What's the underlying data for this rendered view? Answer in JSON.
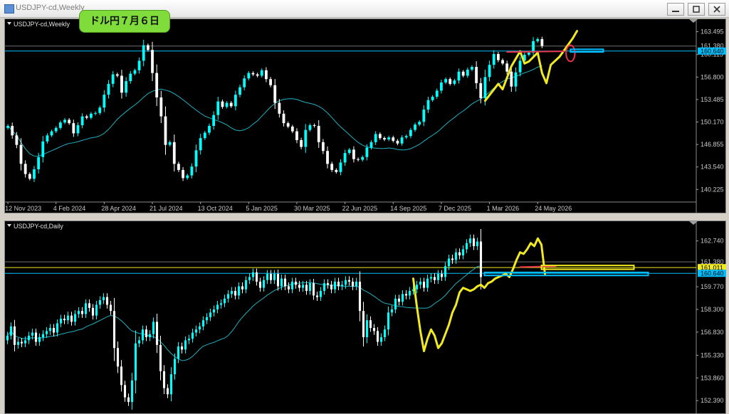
{
  "window": {
    "title": "USDJPY-cd,Weekly",
    "badge": "ドル円７月６日"
  },
  "colors": {
    "bull": "#00ffff",
    "bear": "#ffffff",
    "ma": "#20b0c0",
    "yellow": "#f2ea20",
    "red": "#e8334b",
    "line": "#00bfff",
    "axis": "#c8c8c8",
    "accent": "#7fdc3a"
  },
  "chart_data": [
    {
      "type": "candlestick",
      "title": "USDJPY-cd,Weekly",
      "ylim": [
        139.0,
        164.6
      ],
      "yticks": [
        "163.495",
        "160.115",
        "156.800",
        "153.485",
        "150.170",
        "146.855",
        "143.540",
        "140.225"
      ],
      "xticks": [
        "12 Nov 2023",
        "4 Feb 2024",
        "28 Apr 2024",
        "21 Jul 2024",
        "13 Oct 2024",
        "5 Jan 2025",
        "30 Mar 2025",
        "22 Jun 2025",
        "14 Sep 2025",
        "7 Dec 2025",
        "1 Mar 2026",
        "24 May 2026"
      ],
      "price_labels": [
        {
          "value": 161.38,
          "text": "161.380",
          "style": "plain"
        },
        {
          "value": 160.64,
          "text": "160.640",
          "style": "highlight"
        }
      ],
      "closes": [
        149.6,
        148.2,
        146.8,
        144.0,
        142.5,
        141.8,
        143.2,
        145.0,
        147.3,
        148.2,
        148.8,
        149.3,
        150.1,
        150.5,
        150.0,
        148.5,
        149.7,
        151.0,
        150.8,
        151.4,
        151.5,
        152.3,
        154.2,
        155.8,
        157.2,
        157.0,
        154.5,
        156.2,
        157.3,
        157.8,
        159.2,
        161.5,
        160.8,
        157.4,
        153.8,
        151.0,
        146.8,
        147.2,
        144.0,
        143.1,
        141.9,
        142.3,
        143.6,
        146.0,
        147.8,
        148.6,
        149.6,
        151.2,
        153.2,
        152.4,
        153.0,
        152.5,
        154.2,
        155.3,
        156.6,
        157.4,
        157.2,
        157.0,
        157.8,
        156.5,
        155.6,
        153.0,
        151.4,
        150.0,
        149.5,
        148.8,
        147.5,
        146.5,
        149.0,
        149.7,
        149.6,
        147.2,
        145.9,
        144.0,
        143.1,
        142.8,
        144.2,
        145.6,
        146.1,
        144.7,
        144.6,
        145.0,
        146.4,
        147.2,
        148.4,
        147.8,
        147.6,
        147.9,
        147.4,
        147.0,
        147.9,
        148.1,
        149.0,
        149.8,
        150.2,
        152.0,
        153.4,
        153.9,
        154.8,
        156.0,
        156.5,
        155.8,
        156.3,
        157.6,
        157.0,
        157.9,
        158.3,
        155.9,
        153.7,
        156.8,
        158.6,
        160.2,
        159.3,
        158.8,
        157.6,
        155.4,
        157.5,
        159.2,
        160.1,
        160.4,
        162.1,
        162.4,
        161.4
      ],
      "ma_period": 20,
      "overlay_marks": [
        {
          "kind": "line",
          "color": "yellow",
          "points": [
            [
              109,
              153.3
            ],
            [
              112,
              155.8
            ],
            [
              113,
              155.0
            ],
            [
              115,
              158.4
            ],
            [
              117,
              160.6
            ],
            [
              118,
              158.8
            ],
            [
              119,
              159.1
            ],
            [
              121,
              160.4
            ],
            [
              122,
              157.4
            ],
            [
              123,
              155.9
            ],
            [
              124,
              158.6
            ],
            [
              126,
              159.8
            ],
            [
              129,
              162.5
            ],
            [
              130,
              163.6
            ]
          ]
        },
        {
          "kind": "line",
          "color": "red",
          "points": [
            [
              114,
              160.5
            ],
            [
              127,
              160.6
            ]
          ]
        },
        {
          "kind": "ellipse",
          "color": "red",
          "center": [
            128.5,
            160.3
          ],
          "radii": [
            1.0,
            1.2
          ]
        },
        {
          "kind": "rect",
          "color": "line",
          "x": [
            128.5,
            136
          ],
          "y": [
            160.5,
            160.9
          ]
        }
      ]
    },
    {
      "type": "candlestick",
      "title": "USDJPY-cd,Daily",
      "ylim": [
        151.8,
        163.6
      ],
      "yticks": [
        "162.740",
        "161.380",
        "161.011",
        "160.640",
        "159.770",
        "158.300",
        "156.830",
        "155.330",
        "153.860",
        "152.390"
      ],
      "price_labels": [
        {
          "value": 161.38,
          "text": "161.380",
          "style": "plain"
        },
        {
          "value": 161.011,
          "text": "161.011",
          "style": "yellow"
        },
        {
          "value": 160.64,
          "text": "160.640",
          "style": "highlight"
        }
      ],
      "closes": [
        156.6,
        157.2,
        156.0,
        156.2,
        156.1,
        156.3,
        156.6,
        156.8,
        156.2,
        156.5,
        156.7,
        156.9,
        157.1,
        156.8,
        157.4,
        157.7,
        157.6,
        157.9,
        157.5,
        158.0,
        158.2,
        158.0,
        158.7,
        158.4,
        157.9,
        158.6,
        158.9,
        159.1,
        158.6,
        158.2,
        155.8,
        154.6,
        153.4,
        152.6,
        152.3,
        153.7,
        156.1,
        156.3,
        157.0,
        156.5,
        156.7,
        157.5,
        156.0,
        154.3,
        153.2,
        152.8,
        154.1,
        155.1,
        155.9,
        155.7,
        156.3,
        156.4,
        156.8,
        157.0,
        157.2,
        157.6,
        157.8,
        158.1,
        158.3,
        158.6,
        158.7,
        159.0,
        159.3,
        159.5,
        159.2,
        159.8,
        159.6,
        160.2,
        160.4,
        160.7,
        160.1,
        159.7,
        160.2,
        160.6,
        160.2,
        160.6,
        159.8,
        160.3,
        159.8,
        159.6,
        160.1,
        159.9,
        159.7,
        159.9,
        159.5,
        160.0,
        159.2,
        159.1,
        159.5,
        160.0,
        159.9,
        159.6,
        160.1,
        159.8,
        159.9,
        160.2,
        160.1,
        159.8,
        160.1,
        158.2,
        156.5,
        157.6,
        157.1,
        156.9,
        156.2,
        156.5,
        157.0,
        158.1,
        158.3,
        159.0,
        158.8,
        159.3,
        159.2,
        159.5,
        159.6,
        159.9,
        160.1,
        159.7,
        160.3,
        160.4,
        160.2,
        160.6,
        160.4,
        161.1,
        161.6,
        161.5,
        162.0,
        161.8,
        162.2,
        162.6,
        162.9,
        162.4,
        162.7,
        160.4
      ],
      "ma_period": 20,
      "overlay_marks": [
        {
          "kind": "line",
          "color": "yellow",
          "points": [
            [
              114,
              160.3
            ],
            [
              115,
              158.5
            ],
            [
              116,
              156.9
            ],
            [
              117,
              155.6
            ],
            [
              118,
              156.4
            ],
            [
              119,
              157.0
            ],
            [
              120,
              156.6
            ],
            [
              121,
              155.8
            ],
            [
              122,
              156.1
            ],
            [
              123,
              156.7
            ],
            [
              124,
              157.3
            ],
            [
              125,
              158.1
            ],
            [
              126,
              158.6
            ],
            [
              127,
              159.4
            ],
            [
              128,
              159.7
            ],
            [
              129,
              159.6
            ],
            [
              130,
              159.5
            ],
            [
              131,
              159.6
            ],
            [
              132,
              159.8
            ],
            [
              133,
              159.9
            ],
            [
              134,
              159.7
            ],
            [
              135,
              160.0
            ],
            [
              136,
              160.1
            ],
            [
              137,
              160.3
            ],
            [
              138,
              160.4
            ],
            [
              139,
              160.5
            ],
            [
              140,
              160.6
            ],
            [
              141,
              160.4
            ],
            [
              142,
              160.9
            ],
            [
              143,
              161.5
            ],
            [
              144,
              162.0
            ],
            [
              145,
              161.9
            ],
            [
              146,
              162.2
            ],
            [
              147,
              162.6
            ],
            [
              148,
              162.4
            ],
            [
              149,
              162.9
            ],
            [
              150,
              162.5
            ],
            [
              151,
              160.6
            ]
          ]
        },
        {
          "kind": "line",
          "color": "red",
          "points": [
            [
              144,
              161.05
            ],
            [
              154,
              161.1
            ]
          ]
        },
        {
          "kind": "rect",
          "color": "yellow",
          "x": [
            150,
            176
          ],
          "y": [
            160.9,
            161.15
          ]
        },
        {
          "kind": "rect",
          "color": "line",
          "x": [
            134,
            180
          ],
          "y": [
            160.5,
            160.7
          ]
        }
      ]
    }
  ]
}
